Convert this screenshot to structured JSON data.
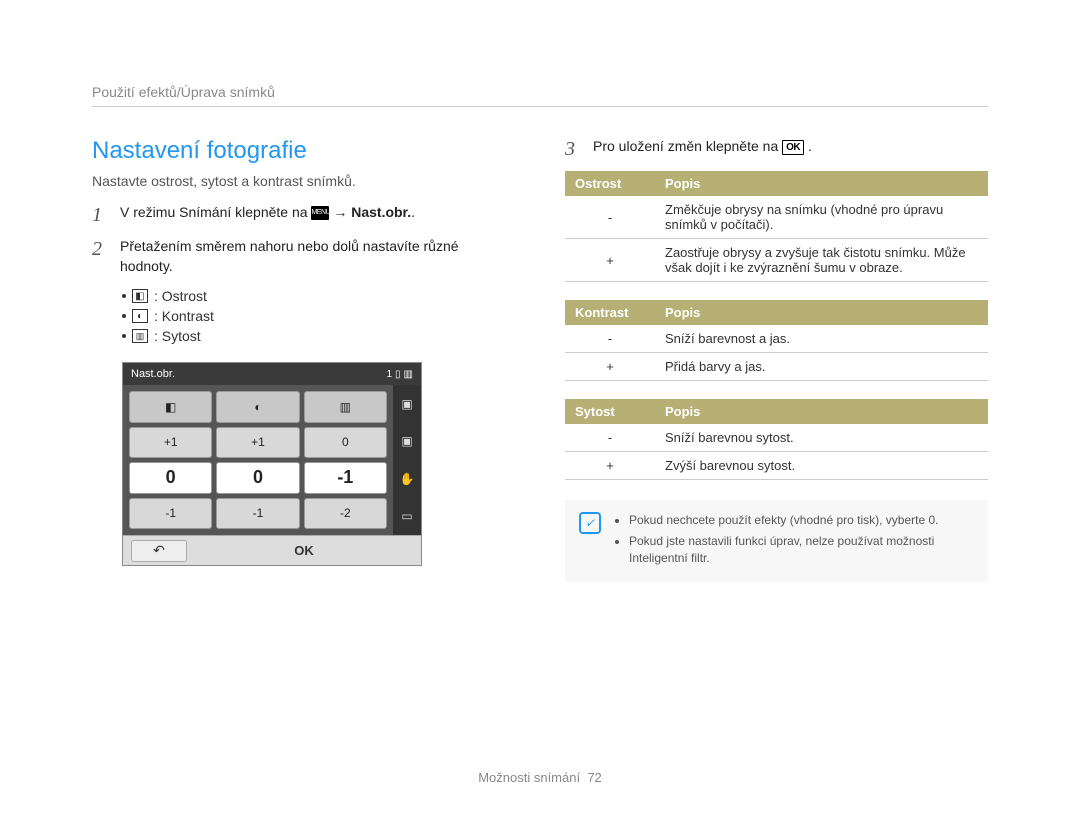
{
  "breadcrumb": "Použití efektů/Úprava snímků",
  "title": "Nastavení fotografie",
  "subtitle": "Nastavte ostrost, sytost a kontrast snímků.",
  "steps": {
    "s1": {
      "num": "1",
      "prefix": "V režimu Snímání klepněte na ",
      "menu_label": "MENU",
      "arrow": "→",
      "target": "Nast.obr.",
      "suffix": "."
    },
    "s2": {
      "num": "2",
      "text": "Přetažením směrem nahoru nebo dolů nastavíte různé hodnoty."
    },
    "s3": {
      "num": "3",
      "prefix": "Pro uložení změn klepněte na ",
      "ok_label": "OK",
      "suffix": "."
    }
  },
  "icon_list": {
    "sharpness": ": Ostrost",
    "contrast": ": Kontrast",
    "saturation": ": Sytost"
  },
  "screenshot": {
    "title": "Nast.obr.",
    "count": "1",
    "headers": [
      "◧",
      "◐",
      "▥"
    ],
    "rows": {
      "top": [
        "+1",
        "+1",
        "0"
      ],
      "mid": [
        "0",
        "0",
        "-1"
      ],
      "bot": [
        "-1",
        "-1",
        "-2"
      ]
    },
    "side": [
      "▣",
      "▣",
      "✋",
      "▭"
    ],
    "back": "↶",
    "ok": "OK"
  },
  "tables": {
    "ostrost": {
      "col1": "Ostrost",
      "col2": "Popis",
      "rows": [
        {
          "k": "-",
          "v": "Změkčuje obrysy na snímku (vhodné pro úpravu snímků v počítači)."
        },
        {
          "k": "+",
          "v": "Zaostřuje obrysy a zvyšuje tak čistotu snímku. Může však dojít i ke zvýraznění šumu v obraze."
        }
      ]
    },
    "kontrast": {
      "col1": "Kontrast",
      "col2": "Popis",
      "rows": [
        {
          "k": "-",
          "v": "Sníží barevnost a jas."
        },
        {
          "k": "+",
          "v": "Přidá barvy a jas."
        }
      ]
    },
    "sytost": {
      "col1": "Sytost",
      "col2": "Popis",
      "rows": [
        {
          "k": "-",
          "v": "Sníží barevnou sytost."
        },
        {
          "k": "+",
          "v": "Zvýší barevnou sytost."
        }
      ]
    }
  },
  "note": {
    "items": [
      "Pokud nechcete použít efekty (vhodné pro tisk), vyberte 0.",
      "Pokud jste nastavili funkci úprav, nelze používat možnosti Inteligentní filtr."
    ]
  },
  "footer": {
    "label": "Možnosti snímání",
    "page": "72"
  }
}
